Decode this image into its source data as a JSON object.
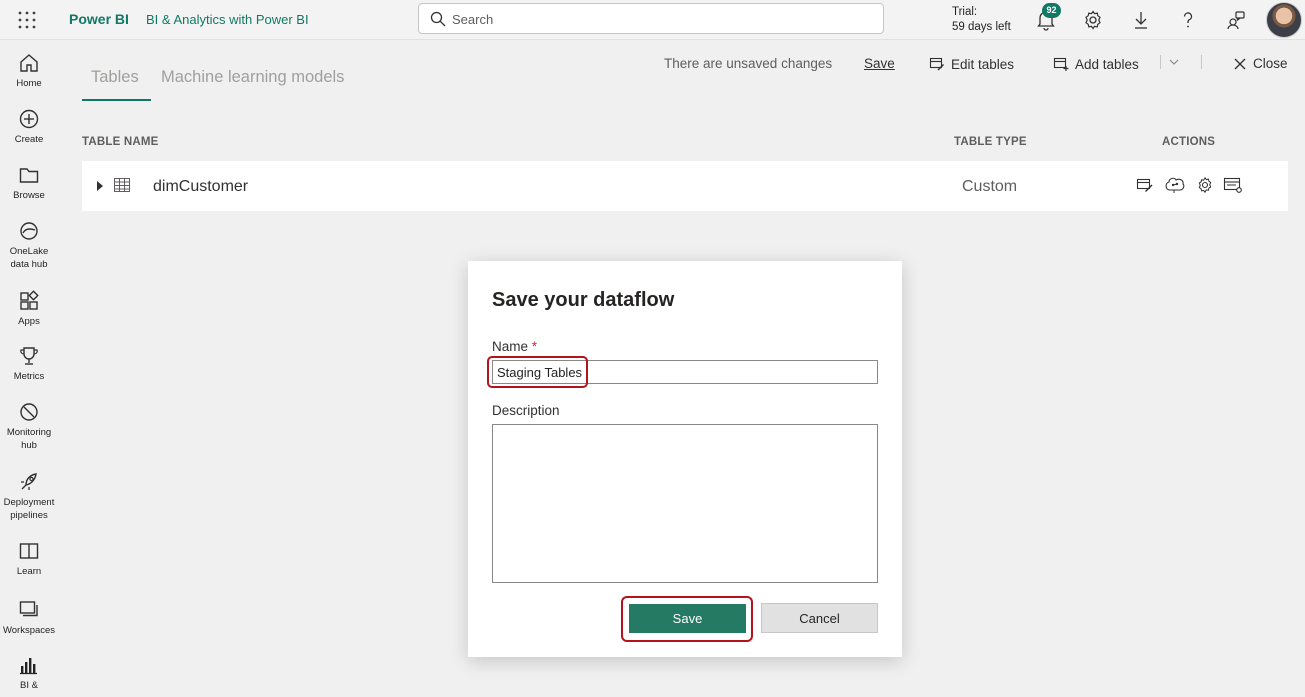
{
  "topbar": {
    "brand": "Power BI",
    "workspace": "BI & Analytics with Power BI",
    "search_placeholder": "Search",
    "trial_line1": "Trial:",
    "trial_line2": "59 days left",
    "notification_count": "92",
    "icons": [
      "app-launcher-icon",
      "search-icon",
      "bell-icon",
      "gear-icon",
      "download-icon",
      "help-icon",
      "share-feedback-icon"
    ]
  },
  "leftnav": {
    "items": [
      {
        "label": "Home",
        "icon": "home-icon"
      },
      {
        "label": "Create",
        "icon": "plus-circle-icon"
      },
      {
        "label": "Browse",
        "icon": "folder-icon"
      },
      {
        "label": "OneLake data hub",
        "icon": "onelake-icon"
      },
      {
        "label": "Apps",
        "icon": "apps-icon"
      },
      {
        "label": "Metrics",
        "icon": "trophy-icon"
      },
      {
        "label": "Monitoring hub",
        "icon": "monitoring-icon"
      },
      {
        "label": "Deployment pipelines",
        "icon": "rocket-icon"
      },
      {
        "label": "Learn",
        "icon": "book-icon"
      },
      {
        "label": "Workspaces",
        "icon": "workspaces-icon"
      },
      {
        "label": "BI &",
        "icon": "bar-chart-icon"
      }
    ]
  },
  "tabs": [
    "Tables",
    "Machine learning models"
  ],
  "commandbar": {
    "unsaved": "There are unsaved changes",
    "save": "Save",
    "edit_tables": "Edit tables",
    "add_tables": "Add tables",
    "close": "Close"
  },
  "table": {
    "headers": {
      "name": "TABLE NAME",
      "type": "TABLE TYPE",
      "actions": "ACTIONS"
    },
    "rows": [
      {
        "name": "dimCustomer",
        "type": "Custom"
      }
    ]
  },
  "dialog": {
    "title": "Save your dataflow",
    "name_label": "Name",
    "required_mark": "*",
    "name_value": "Staging Tables",
    "description_label": "Description",
    "description_value": "",
    "save_label": "Save",
    "cancel_label": "Cancel"
  },
  "colors": {
    "accent": "#117865",
    "save_button": "#257a63",
    "highlight": "#b4121c"
  }
}
